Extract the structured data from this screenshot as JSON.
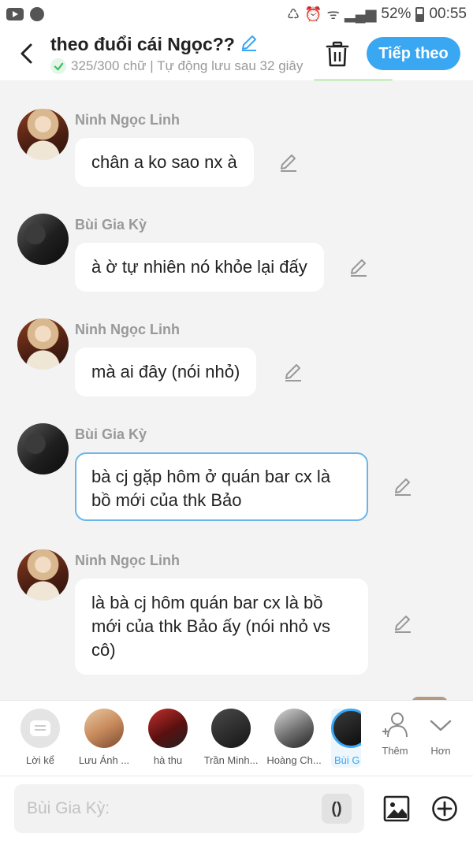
{
  "status_bar": {
    "battery": "52%",
    "time": "00:55"
  },
  "header": {
    "title": "theo đuổi cái Ngọc??",
    "subtitle": "325/300 chữ | Tự động lưu sau 32 giây",
    "next_label": "Tiếp theo"
  },
  "messages": [
    {
      "sender": "Ninh Ngọc Linh",
      "text": "chân a ko sao nx à"
    },
    {
      "sender": "Bùi Gia Kỳ",
      "text": "à ờ tự nhiên nó khỏe lại đấy"
    },
    {
      "sender": "Ninh Ngọc Linh",
      "text": "mà ai đây (nói nhỏ)"
    },
    {
      "sender": "Bùi Gia Kỳ",
      "text": "bà cj gặp hôm ở quán bar cx là bồ mới của thk Bảo"
    },
    {
      "sender": "Ninh Ngọc Linh",
      "text": "là bà cj hôm quán bar cx là bồ mới của thk Bảo ấy (nói nhỏ vs cô)"
    }
  ],
  "characters": [
    {
      "name": "Lời kể"
    },
    {
      "name": "Lưu Ánh ..."
    },
    {
      "name": "hà thu"
    },
    {
      "name": "Trần Minh..."
    },
    {
      "name": "Hoàng Ch..."
    },
    {
      "name": "Bùi G"
    }
  ],
  "character_actions": {
    "add_label": "Thêm",
    "more_label": "Hơn"
  },
  "input": {
    "placeholder": "Bùi Gia Kỳ:",
    "paren_label": "()"
  }
}
